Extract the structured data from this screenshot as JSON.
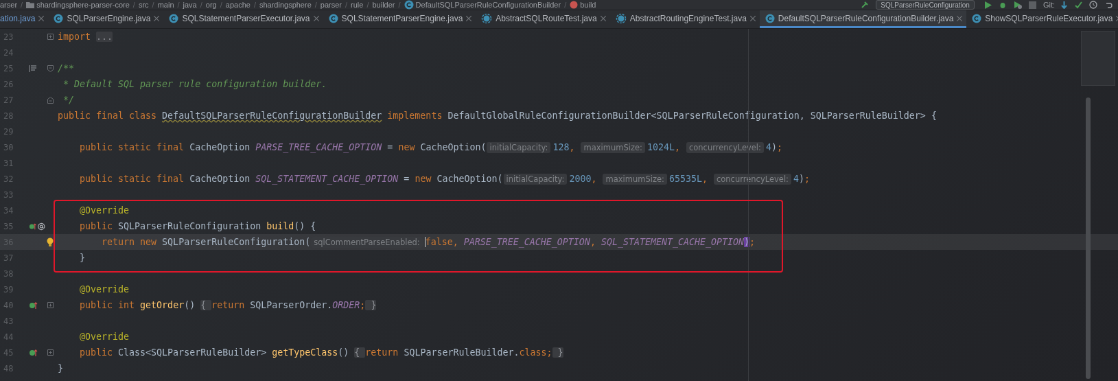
{
  "breadcrumb": {
    "separator": "/",
    "items": [
      {
        "label": "arser",
        "kind": "folder"
      },
      {
        "label": "shardingsphere-parser-core",
        "kind": "module"
      },
      {
        "label": "src",
        "kind": "folder"
      },
      {
        "label": "main",
        "kind": "folder"
      },
      {
        "label": "java",
        "kind": "folder"
      },
      {
        "label": "org",
        "kind": "folder"
      },
      {
        "label": "apache",
        "kind": "folder"
      },
      {
        "label": "shardingsphere",
        "kind": "folder"
      },
      {
        "label": "parser",
        "kind": "folder"
      },
      {
        "label": "rule",
        "kind": "folder"
      },
      {
        "label": "builder",
        "kind": "folder"
      },
      {
        "label": "DefaultSQLParserRuleConfigurationBuilder",
        "kind": "class"
      },
      {
        "label": "build",
        "kind": "method"
      }
    ]
  },
  "toolbar": {
    "run_config": "SQLParserRuleConfiguration",
    "vcs_label": "Git:"
  },
  "tabs": [
    {
      "label": "ation.java",
      "kind": "plain",
      "selected": false
    },
    {
      "label": "SQLParserEngine.java",
      "kind": "class",
      "selected": false
    },
    {
      "label": "SQLStatementParserExecutor.java",
      "kind": "class",
      "selected": false
    },
    {
      "label": "SQLStatementParserEngine.java",
      "kind": "class",
      "selected": false
    },
    {
      "label": "AbstractSQLRouteTest.java",
      "kind": "abstract",
      "selected": false
    },
    {
      "label": "AbstractRoutingEngineTest.java",
      "kind": "abstract",
      "selected": false
    },
    {
      "label": "DefaultSQLParserRuleConfigurationBuilder.java",
      "kind": "class",
      "selected": true
    },
    {
      "label": "ShowSQLParserRuleExecutor.java",
      "kind": "class",
      "selected": false
    }
  ],
  "lines": [
    {
      "number": "23",
      "fold": {
        "kind": "collapsed"
      },
      "tokens": [
        {
          "text": "import ",
          "kind": "keyword"
        },
        {
          "text": "...",
          "kind": "folded"
        }
      ]
    },
    {
      "number": "24"
    },
    {
      "number": "25",
      "marker": {
        "kind": "doc"
      },
      "fold": {
        "kind": "start"
      },
      "tokens": [
        {
          "text": "/**",
          "kind": "comment"
        }
      ]
    },
    {
      "number": "26",
      "tokens": [
        {
          "text": " * Default SQL parser rule configuration builder.",
          "kind": "comment"
        }
      ]
    },
    {
      "number": "27",
      "fold": {
        "kind": "end"
      },
      "tokens": [
        {
          "text": " */",
          "kind": "comment"
        }
      ]
    },
    {
      "number": "28",
      "tokens": [
        {
          "text": "public final class ",
          "kind": "keyword"
        },
        {
          "text": "DefaultSQLParserRuleConfigurationBuilder",
          "kind": "class_name"
        },
        {
          "text": " implements ",
          "kind": "keyword"
        },
        {
          "text": "DefaultGlobalRuleConfigurationBuilder<SQLParserRuleConfiguration, SQLParserRuleBuilder> {",
          "kind": "plain"
        }
      ]
    },
    {
      "number": "29"
    },
    {
      "number": "30",
      "tokens": [
        {
          "text": "    public static final ",
          "kind": "keyword"
        },
        {
          "text": "CacheOption ",
          "kind": "plain"
        },
        {
          "text": "PARSE_TREE_CACHE_OPTION",
          "kind": "constant"
        },
        {
          "text": " = ",
          "kind": "plain"
        },
        {
          "text": "new ",
          "kind": "keyword"
        },
        {
          "text": "CacheOption(",
          "kind": "plain"
        },
        {
          "text": "initialCapacity:",
          "kind": "hint"
        },
        {
          "text": "128",
          "kind": "number"
        },
        {
          "text": ", ",
          "kind": "keyword"
        },
        {
          "text": "maximumSize:",
          "kind": "hint"
        },
        {
          "text": "1024L",
          "kind": "number"
        },
        {
          "text": ", ",
          "kind": "keyword"
        },
        {
          "text": "concurrencyLevel:",
          "kind": "hint"
        },
        {
          "text": "4",
          "kind": "number"
        },
        {
          "text": ")",
          "kind": "plain"
        },
        {
          "text": ";",
          "kind": "keyword"
        }
      ]
    },
    {
      "number": "31"
    },
    {
      "number": "32",
      "tokens": [
        {
          "text": "    public static final ",
          "kind": "keyword"
        },
        {
          "text": "CacheOption ",
          "kind": "plain"
        },
        {
          "text": "SQL_STATEMENT_CACHE_OPTION",
          "kind": "constant"
        },
        {
          "text": " = ",
          "kind": "plain"
        },
        {
          "text": "new ",
          "kind": "keyword"
        },
        {
          "text": "CacheOption(",
          "kind": "plain"
        },
        {
          "text": "initialCapacity:",
          "kind": "hint"
        },
        {
          "text": "2000",
          "kind": "number"
        },
        {
          "text": ", ",
          "kind": "keyword"
        },
        {
          "text": "maximumSize:",
          "kind": "hint"
        },
        {
          "text": "65535L",
          "kind": "number"
        },
        {
          "text": ", ",
          "kind": "keyword"
        },
        {
          "text": "concurrencyLevel:",
          "kind": "hint"
        },
        {
          "text": "4",
          "kind": "number"
        },
        {
          "text": ")",
          "kind": "plain"
        },
        {
          "text": ";",
          "kind": "keyword"
        }
      ]
    },
    {
      "number": "33"
    },
    {
      "number": "34",
      "boxed": true,
      "tokens": [
        {
          "text": "    @Override",
          "kind": "annotation"
        }
      ]
    },
    {
      "number": "35",
      "boxed": true,
      "marker": {
        "kind": "implements_at"
      },
      "tokens": [
        {
          "text": "    public ",
          "kind": "keyword"
        },
        {
          "text": "SQLParserRuleConfiguration ",
          "kind": "plain"
        },
        {
          "text": "build",
          "kind": "method"
        },
        {
          "text": "() {",
          "kind": "plain"
        }
      ]
    },
    {
      "number": "36",
      "boxed": true,
      "current": true,
      "bulb": true,
      "tokens": [
        {
          "text": "        return new ",
          "kind": "keyword"
        },
        {
          "text": "SQLParserRuleConfiguration(",
          "kind": "plain"
        },
        {
          "text": "sqlCommentParseEnabled:",
          "kind": "hint"
        },
        {
          "text": "false",
          "kind": "keyword",
          "caret": true
        },
        {
          "text": ", ",
          "kind": "keyword"
        },
        {
          "text": "PARSE_TREE_CACHE_OPTION",
          "kind": "constant"
        },
        {
          "text": ", ",
          "kind": "keyword"
        },
        {
          "text": "SQL_STATEMENT_CACHE_OPTION",
          "kind": "constant"
        },
        {
          "text": ")",
          "kind": "matched_paren"
        },
        {
          "text": ";",
          "kind": "keyword"
        }
      ]
    },
    {
      "number": "37",
      "boxed": true,
      "tokens": [
        {
          "text": "    }",
          "kind": "plain"
        }
      ]
    },
    {
      "number": "38"
    },
    {
      "number": "39",
      "tokens": [
        {
          "text": "    @Override",
          "kind": "annotation"
        }
      ]
    },
    {
      "number": "40",
      "marker": {
        "kind": "implements"
      },
      "fold": {
        "kind": "collapsed"
      },
      "tokens": [
        {
          "text": "    public int ",
          "kind": "keyword"
        },
        {
          "text": "getOrder",
          "kind": "method"
        },
        {
          "text": "() ",
          "kind": "plain"
        },
        {
          "text": "{ ",
          "kind": "folded"
        },
        {
          "text": "return ",
          "kind": "keyword"
        },
        {
          "text": "SQLParserOrder.",
          "kind": "plain"
        },
        {
          "text": "ORDER",
          "kind": "constant"
        },
        {
          "text": ";",
          "kind": "keyword"
        },
        {
          "text": " }",
          "kind": "folded"
        }
      ]
    },
    {
      "number": "43"
    },
    {
      "number": "44",
      "tokens": [
        {
          "text": "    @Override",
          "kind": "annotation"
        }
      ]
    },
    {
      "number": "45",
      "marker": {
        "kind": "implements"
      },
      "fold": {
        "kind": "collapsed"
      },
      "tokens": [
        {
          "text": "    public ",
          "kind": "keyword"
        },
        {
          "text": "Class<SQLParserRuleBuilder> ",
          "kind": "plain"
        },
        {
          "text": "getTypeClass",
          "kind": "method"
        },
        {
          "text": "() ",
          "kind": "plain"
        },
        {
          "text": "{ ",
          "kind": "folded"
        },
        {
          "text": "return ",
          "kind": "keyword"
        },
        {
          "text": "SQLParserRuleBuilder.",
          "kind": "plain"
        },
        {
          "text": "class",
          "kind": "keyword"
        },
        {
          "text": ";",
          "kind": "keyword"
        },
        {
          "text": " }",
          "kind": "folded"
        }
      ]
    },
    {
      "number": "48",
      "tokens": [
        {
          "text": "}",
          "kind": "plain"
        }
      ]
    }
  ]
}
